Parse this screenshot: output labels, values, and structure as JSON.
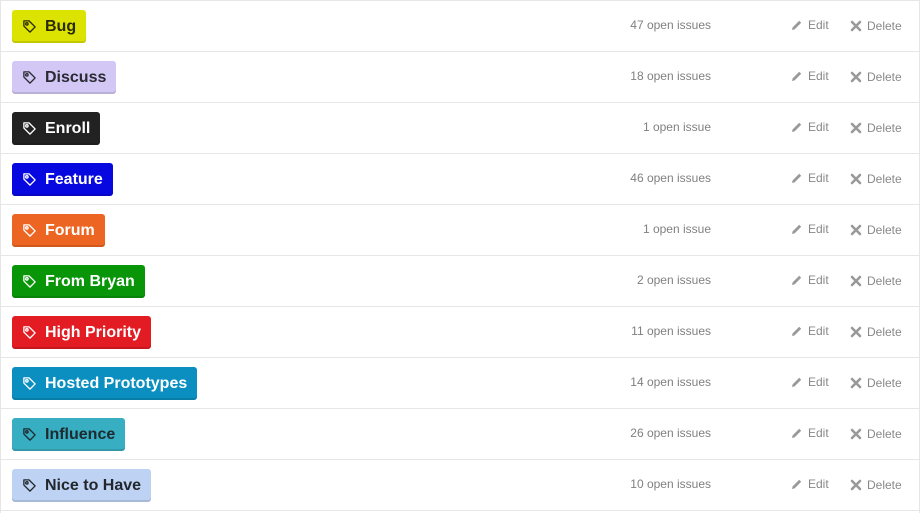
{
  "actions": {
    "edit_label": "Edit",
    "delete_label": "Delete",
    "edit_icon": "pencil-icon",
    "delete_icon": "x-icon",
    "label_icon": "tag-icon"
  },
  "labels": [
    {
      "name": "Bug",
      "count": "47 open issues",
      "bg": "#dde300",
      "fg": "#2b2b00"
    },
    {
      "name": "Discuss",
      "count": "18 open issues",
      "bg": "#d3c8f5",
      "fg": "#2a2a33"
    },
    {
      "name": "Enroll",
      "count": "1 open issue",
      "bg": "#222222",
      "fg": "#ffffff"
    },
    {
      "name": "Feature",
      "count": "46 open issues",
      "bg": "#0707e0",
      "fg": "#ffffff"
    },
    {
      "name": "Forum",
      "count": "1 open issue",
      "bg": "#ec6522",
      "fg": "#ffffff"
    },
    {
      "name": "From Bryan",
      "count": "2 open issues",
      "bg": "#089608",
      "fg": "#ffffff"
    },
    {
      "name": "High Priority",
      "count": "11 open issues",
      "bg": "#e31b23",
      "fg": "#ffffff"
    },
    {
      "name": "Hosted Prototypes",
      "count": "14 open issues",
      "bg": "#0a8fc0",
      "fg": "#ffffff"
    },
    {
      "name": "Influence",
      "count": "26 open issues",
      "bg": "#38aec2",
      "fg": "#1e2a30"
    },
    {
      "name": "Nice to Have",
      "count": "10 open issues",
      "bg": "#bed3f3",
      "fg": "#22272e"
    }
  ]
}
